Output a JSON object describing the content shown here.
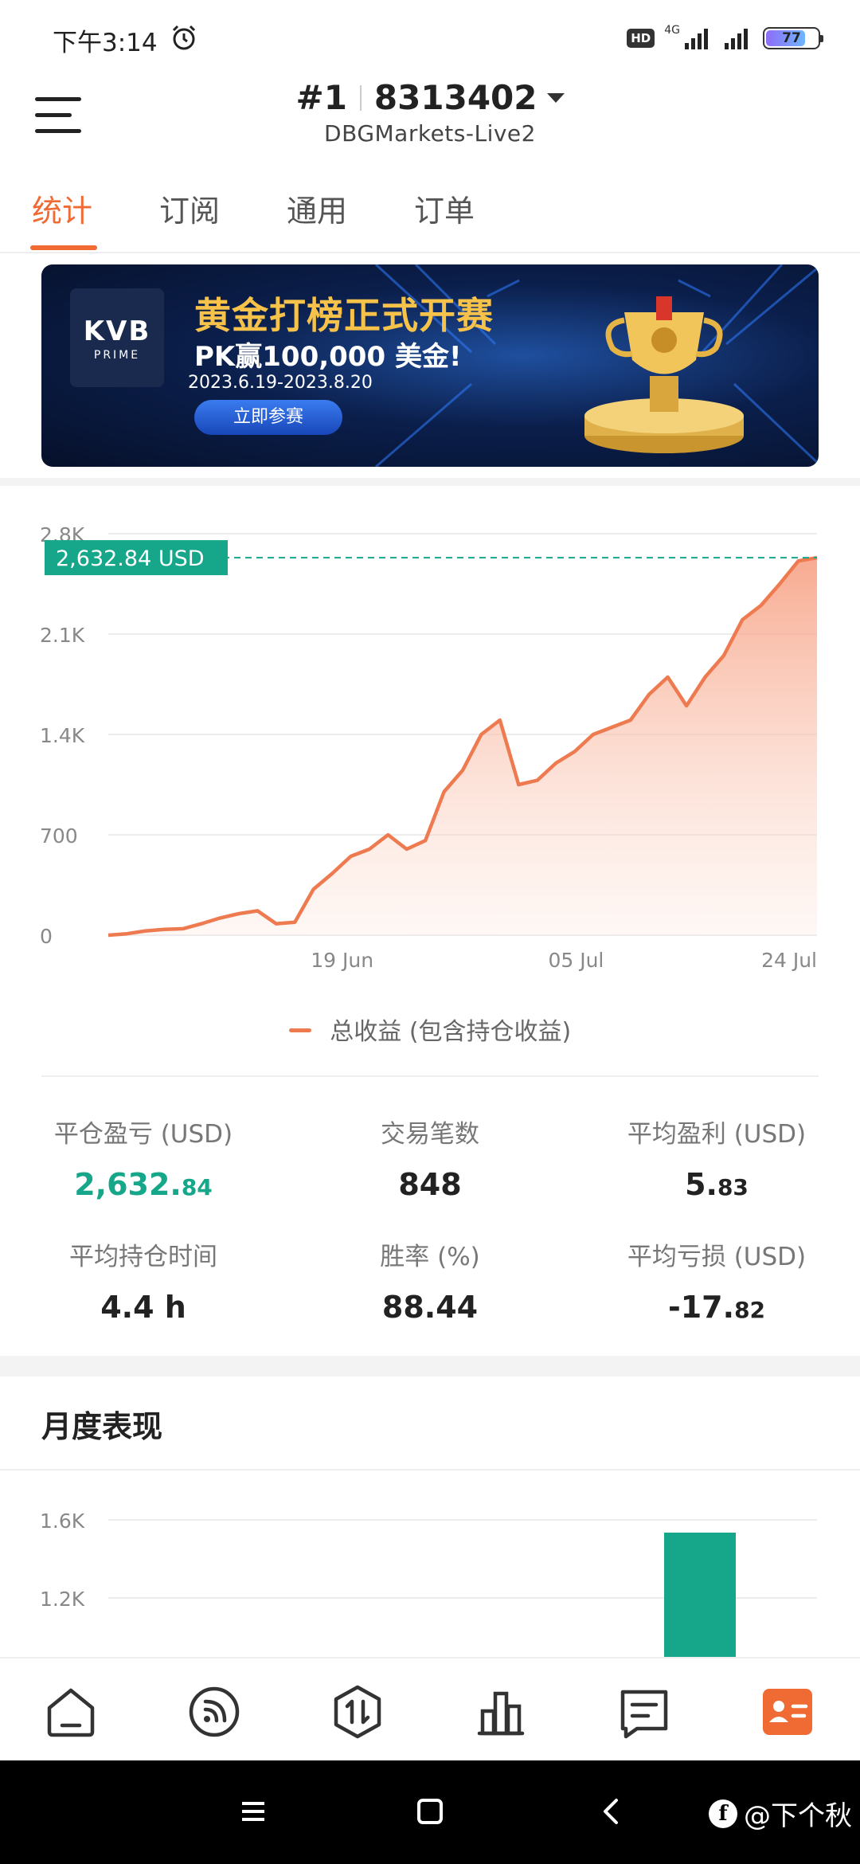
{
  "status_bar": {
    "time": "下午3:14",
    "hd": "HD",
    "network": "4G",
    "battery": "77",
    "battery_level": 0.77
  },
  "header": {
    "rank": "#1",
    "account_number": "8313402",
    "server": "DBGMarkets-Live2"
  },
  "tabs": [
    {
      "label": "统计",
      "active": true
    },
    {
      "label": "订阅",
      "active": false
    },
    {
      "label": "通用",
      "active": false
    },
    {
      "label": "订单",
      "active": false
    }
  ],
  "banner": {
    "logo_main": "KVB",
    "logo_sub": "PRIME",
    "title": "黄金打榜正式开赛",
    "subtitle": "PK赢100,000 美金!",
    "dates": "2023.6.19-2023.8.20",
    "button": "立即参赛"
  },
  "chart_data": {
    "type": "area",
    "y_ticks": [
      "0",
      "700",
      "1.4K",
      "2.1K",
      "2.8K"
    ],
    "ylim": [
      0,
      2800
    ],
    "x_ticks": [
      "19 Jun",
      "05 Jul",
      "24 Jul"
    ],
    "current_value_label": "2,632.84 USD",
    "current_value": 2632.84,
    "legend": "总收益 (包含持仓收益)",
    "line_color": "#ee7a50",
    "marker_color": "#16a68a",
    "series": [
      {
        "values": [
          0,
          10,
          30,
          40,
          45,
          80,
          120,
          150,
          170,
          80,
          90,
          320,
          430,
          550,
          600,
          700,
          600,
          660,
          1000,
          1150,
          1400,
          1500,
          1050,
          1080,
          1200,
          1280,
          1400,
          1450,
          1500,
          1680,
          1800,
          1600,
          1800,
          1950,
          2200,
          2300,
          2450,
          2610,
          2632.84
        ]
      }
    ]
  },
  "stats": [
    {
      "label": "平仓盈亏 (USD)",
      "int": "2,632.",
      "dec": "84",
      "green": true
    },
    {
      "label": "交易笔数",
      "int": "848",
      "dec": "",
      "green": false
    },
    {
      "label": "平均盈利 (USD)",
      "int": "5.",
      "dec": "83",
      "green": false
    },
    {
      "label": "平均持仓时间",
      "int": "4.4 h",
      "dec": "",
      "green": false
    },
    {
      "label": "胜率 (%)",
      "int": "88.44",
      "dec": "",
      "green": false
    },
    {
      "label": "平均亏损 (USD)",
      "int": "-17.",
      "dec": "82",
      "green": false
    }
  ],
  "monthly": {
    "title": "月度表现",
    "chart_data": {
      "type": "bar",
      "y_ticks": [
        "1.2K",
        "1.6K"
      ],
      "bar_color": "#16a68a"
    }
  },
  "bottom_nav": [
    {
      "icon": "home-icon",
      "active": false
    },
    {
      "icon": "signal-feed-icon",
      "active": false
    },
    {
      "icon": "trade-icon",
      "active": false
    },
    {
      "icon": "bar-chart-icon",
      "active": false
    },
    {
      "icon": "message-icon",
      "active": false
    },
    {
      "icon": "profile-card-icon",
      "active": true
    }
  ],
  "watermark": "@下个秋"
}
